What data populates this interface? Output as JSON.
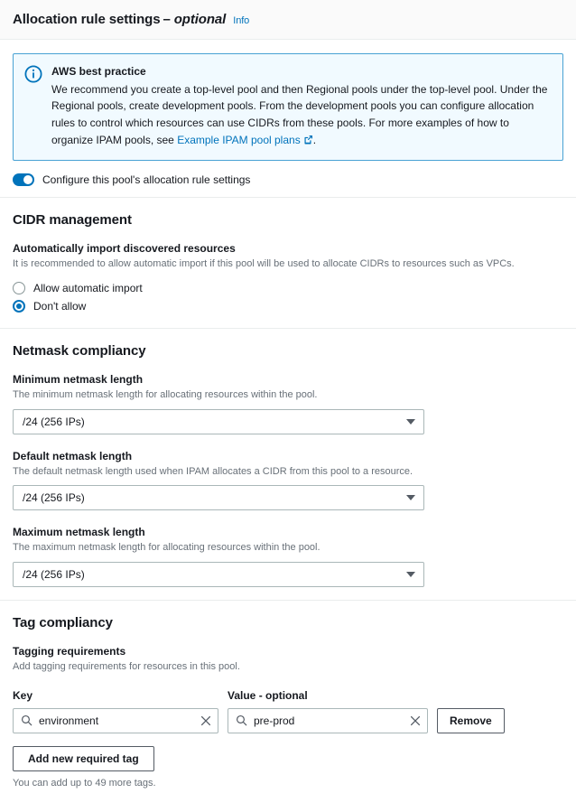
{
  "header": {
    "title": "Allocation rule settings",
    "dash": "–",
    "optional": "optional",
    "info_label": "Info"
  },
  "alert": {
    "icon": "info-circle-icon",
    "title": "AWS best practice",
    "body_before_link": "We recommend you create a top-level pool and then Regional pools under the top-level pool. Under the Regional pools, create development pools. From the development pools you can configure allocation rules to control which resources can use CIDRs from these pools. For more examples of how to organize IPAM pools, see ",
    "link_text": "Example IPAM pool plans",
    "body_after_link": "."
  },
  "toggle": {
    "label": "Configure this pool's allocation rule settings",
    "state": "on"
  },
  "cidr_management": {
    "section_title": "CIDR management",
    "field_label": "Automatically import discovered resources",
    "field_desc": "It is recommended to allow automatic import if this pool will be used to allocate CIDRs to resources such as VPCs.",
    "options": [
      {
        "label": "Allow automatic import",
        "selected": false
      },
      {
        "label": "Don't allow",
        "selected": true
      }
    ]
  },
  "netmask_compliancy": {
    "section_title": "Netmask compliancy",
    "fields": [
      {
        "label": "Minimum netmask length",
        "desc": "The minimum netmask length for allocating resources within the pool.",
        "value": "/24 (256 IPs)"
      },
      {
        "label": "Default netmask length",
        "desc": "The default netmask length used when IPAM allocates a CIDR from this pool to a resource.",
        "value": "/24 (256 IPs)"
      },
      {
        "label": "Maximum netmask length",
        "desc": "The maximum netmask length for allocating resources within the pool.",
        "value": "/24 (256 IPs)"
      }
    ]
  },
  "tag_compliancy": {
    "section_title": "Tag compliancy",
    "field_label": "Tagging requirements",
    "field_desc": "Add tagging requirements for resources in this pool.",
    "key_column_label": "Key",
    "value_column_label": "Value",
    "value_column_optional": "optional",
    "rows": [
      {
        "key": "environment",
        "value": "pre-prod",
        "remove_label": "Remove"
      }
    ],
    "add_button_label": "Add new required tag",
    "hint": "You can add up to 49 more tags."
  },
  "colors": {
    "accent": "#0073bb",
    "alert_bg": "#f1faff",
    "alert_border": "#49a2d4",
    "header_bg": "#fafafa",
    "border": "#eaeded",
    "muted_text": "#687078"
  }
}
